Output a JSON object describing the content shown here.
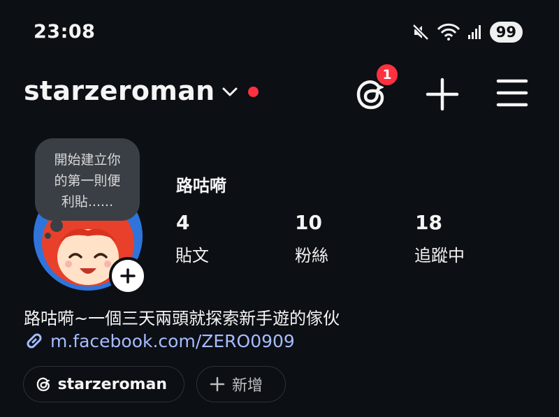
{
  "status_bar": {
    "time": "23:08",
    "battery": "99"
  },
  "header": {
    "username": "starzeroman",
    "notification_count": "1"
  },
  "note": {
    "text_line1": "開始建立你",
    "text_line2": "的第一則便",
    "text_line3": "利貼......"
  },
  "profile": {
    "display_name": "路咕嗬",
    "stats": [
      {
        "value": "4",
        "label": "貼文"
      },
      {
        "value": "10",
        "label": "粉絲"
      },
      {
        "value": "18",
        "label": "追蹤中"
      }
    ],
    "bio": "路咕嗬~一個三天兩頭就探索新手遊的傢伙",
    "link": "m.facebook.com/ZERO0909"
  },
  "chips": {
    "threads_label": "starzeroman",
    "add_label": "新增"
  },
  "icons": [
    "mute-icon",
    "wifi-icon",
    "signal-icon",
    "chevron-down-icon",
    "threads-icon",
    "plus-icon",
    "menu-icon",
    "link-icon"
  ],
  "colors": {
    "background": "#0c0f14",
    "accent_red": "#ff3040",
    "link": "#a6bcff"
  }
}
